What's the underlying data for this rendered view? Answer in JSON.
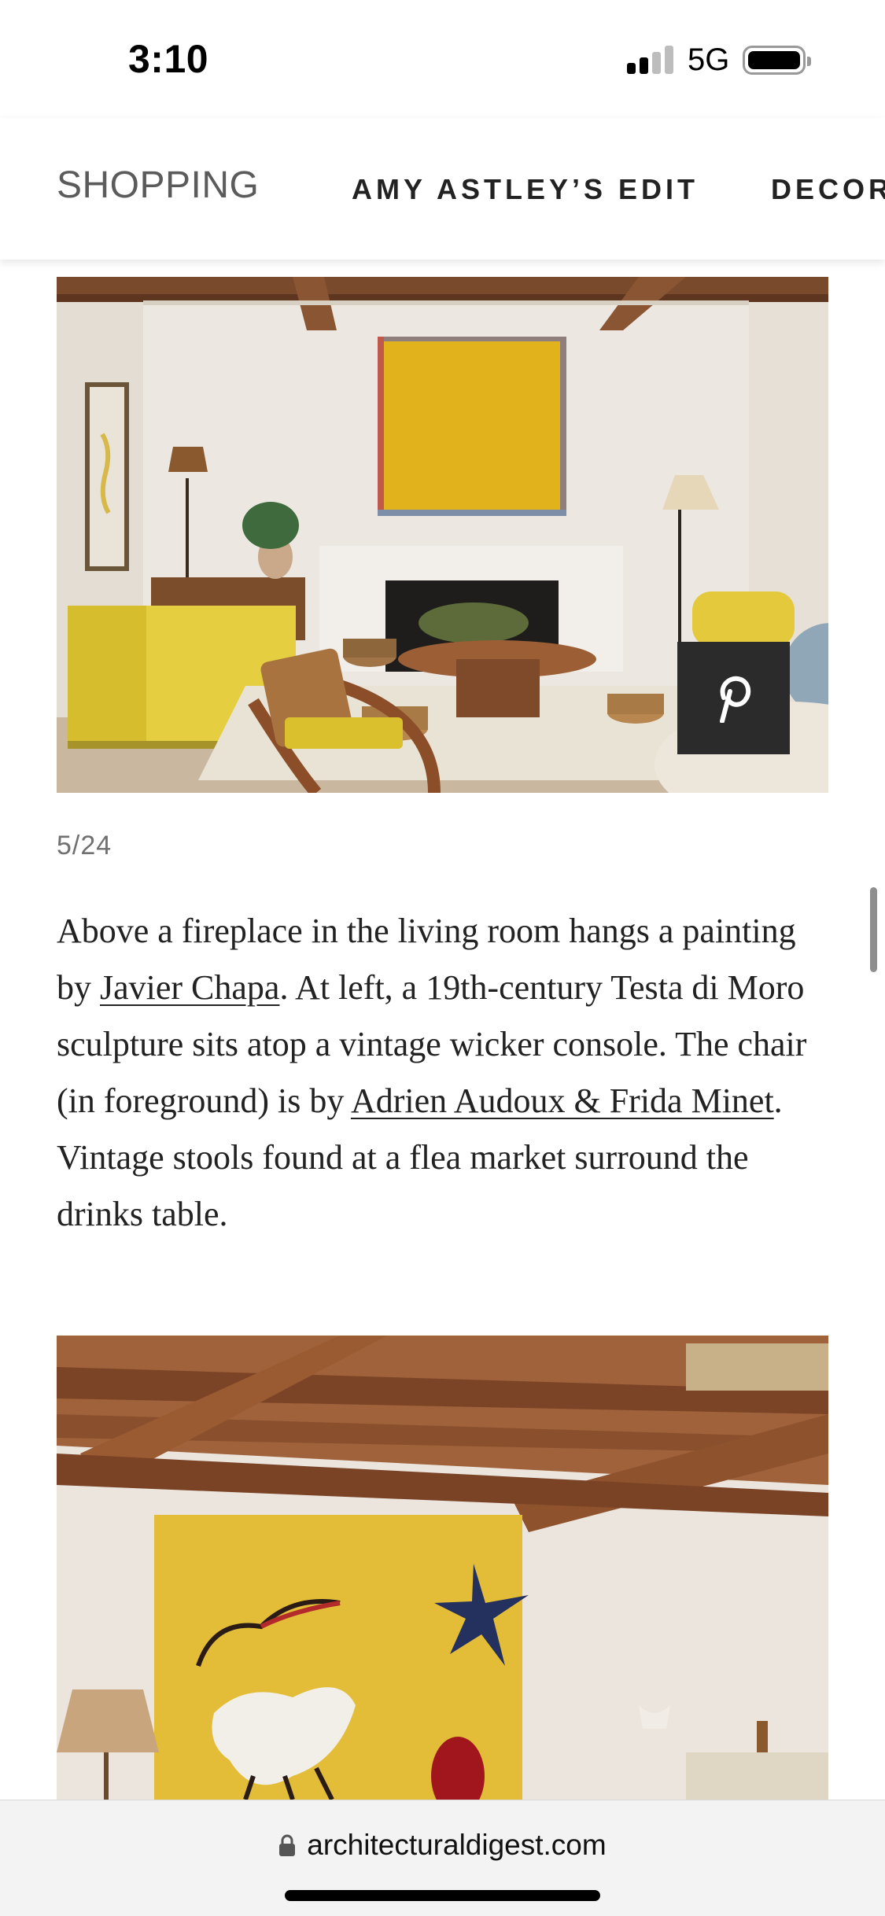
{
  "status_bar": {
    "time": "3:10",
    "network": "5G",
    "signal_bars_active": 2,
    "signal_bars_total": 4,
    "battery_level": 0.95
  },
  "nav": {
    "items": [
      {
        "label": "SHOPPING"
      },
      {
        "label": "AMY ASTLEY’S EDIT"
      },
      {
        "label": "DECOR"
      }
    ]
  },
  "slideshow": {
    "counter": "5/24",
    "pin_icon": "pinterest-icon",
    "caption": {
      "part1": "Above a fireplace in the living room hangs a painting by ",
      "link1": "Javier Chapa",
      "part2": ". At left, a 19th-century Testa di Moro sculpture sits atop a vintage wicker console. The chair (in foreground) is by ",
      "link2": "Adrien Audoux & Frida Minet",
      "part3": ". Vintage stools found at a flea market surround the drinks table."
    }
  },
  "browser": {
    "lock_icon": "lock-icon",
    "url": "architecturaldigest.com"
  },
  "colors": {
    "pin_button_bg": "#2b2b2b",
    "nav_text": "#222222",
    "counter_text": "#707070"
  }
}
